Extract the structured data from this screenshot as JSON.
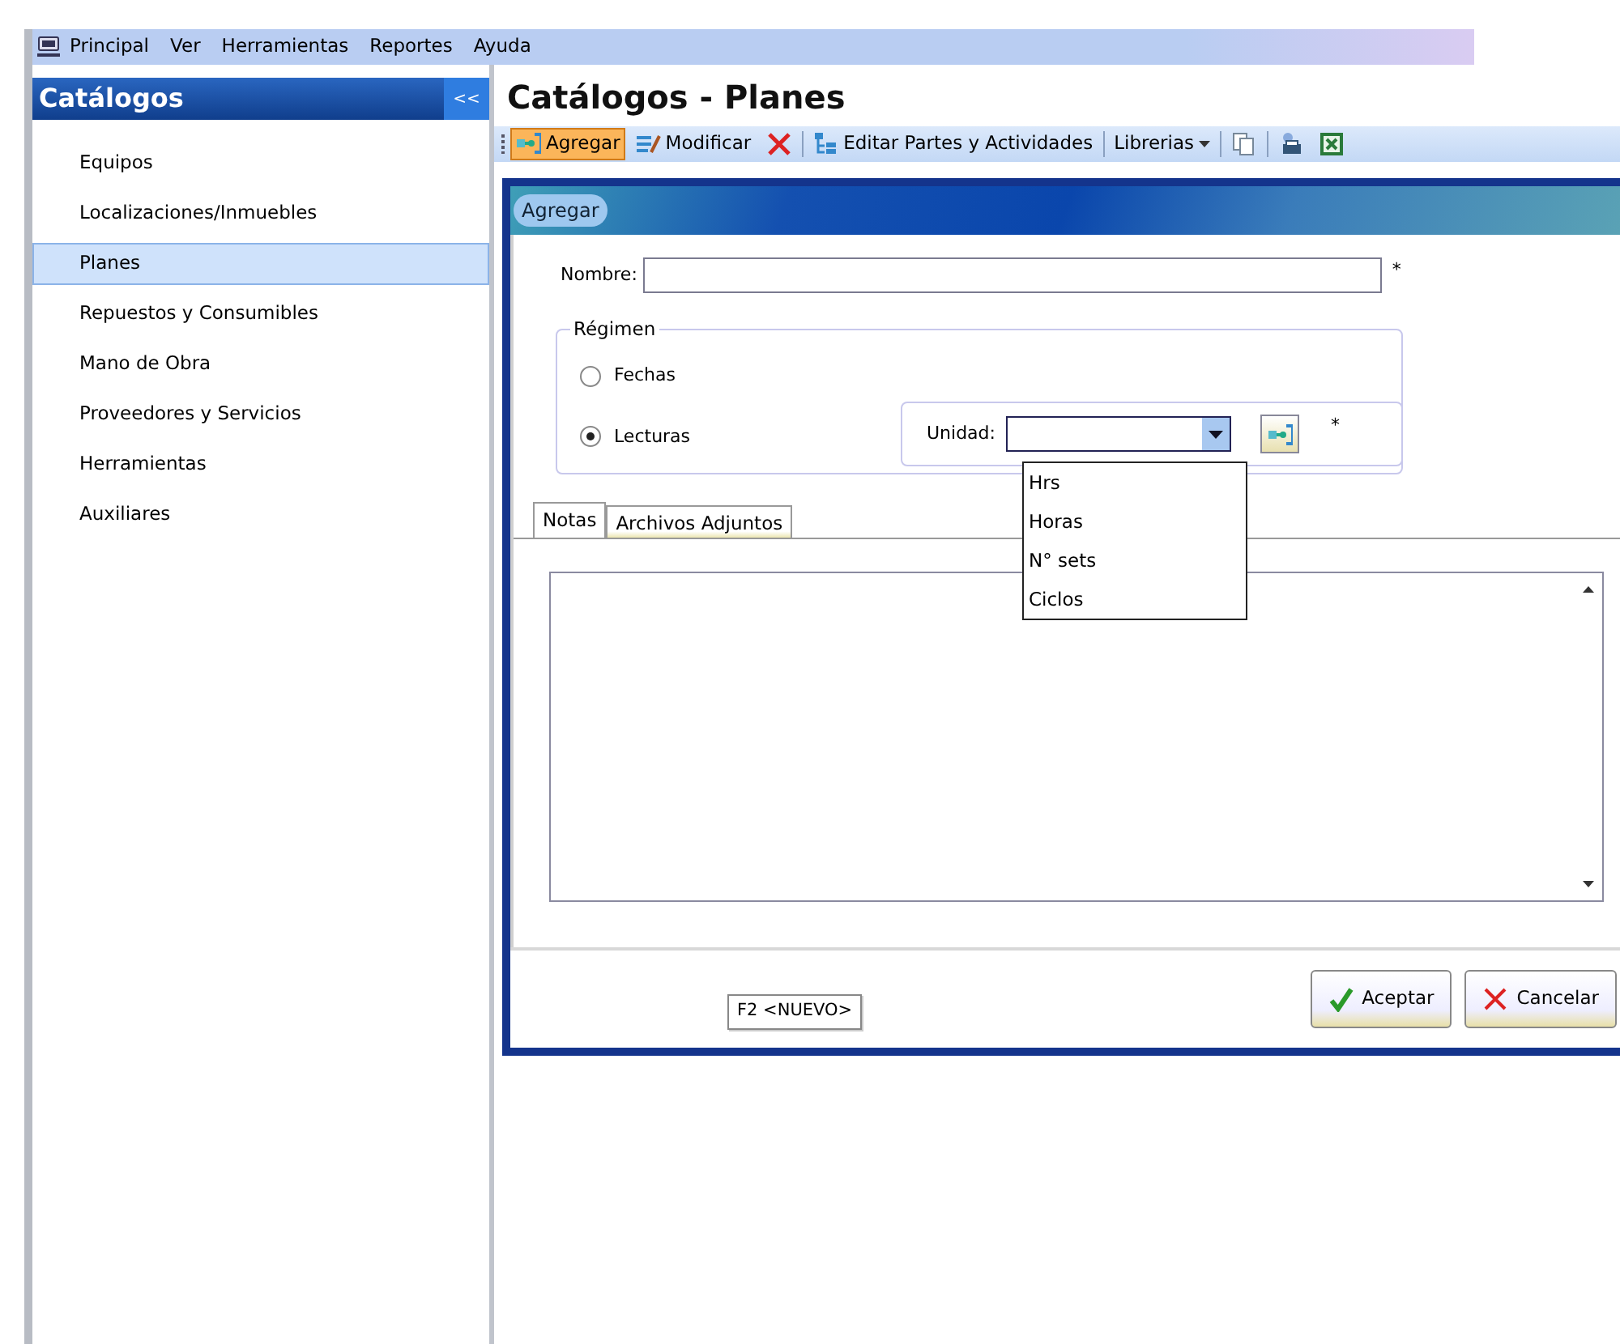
{
  "menu": [
    {
      "label": "Principal"
    },
    {
      "label": "Ver"
    },
    {
      "label": "Herramientas"
    },
    {
      "label": "Reportes"
    },
    {
      "label": "Ayuda"
    }
  ],
  "sidebar": {
    "title": "Catálogos",
    "collapse": "<<",
    "items": [
      {
        "label": "Equipos",
        "selected": false
      },
      {
        "label": "Localizaciones/Inmuebles",
        "selected": false
      },
      {
        "label": "Planes",
        "selected": true
      },
      {
        "label": "Repuestos y Consumibles",
        "selected": false
      },
      {
        "label": "Mano de Obra",
        "selected": false
      },
      {
        "label": "Proveedores y Servicios",
        "selected": false
      },
      {
        "label": "Herramientas",
        "selected": false
      },
      {
        "label": "Auxiliares",
        "selected": false
      }
    ]
  },
  "page_title": "Catálogos - Planes",
  "toolbar": [
    {
      "kind": "button",
      "label": "Agregar",
      "selected": true
    },
    {
      "kind": "button",
      "label": "Modificar",
      "selected": false
    },
    {
      "kind": "button",
      "selected": false
    },
    {
      "kind": "sep"
    },
    {
      "kind": "button",
      "label": "Editar Partes y Actividades",
      "selected": false
    },
    {
      "kind": "sep"
    },
    {
      "kind": "dropdown",
      "label": "Librerias",
      "selected": false
    },
    {
      "kind": "sep"
    },
    {
      "kind": "button",
      "selected": false
    },
    {
      "kind": "sep"
    },
    {
      "kind": "button",
      "selected": false
    },
    {
      "kind": "button",
      "selected": false
    }
  ],
  "dialog": {
    "title": "Agregar",
    "nombre": {
      "label": "Nombre:",
      "required": "*"
    },
    "regimen": {
      "legend": "Régimen",
      "options": [
        {
          "label": "Fechas",
          "selected": false
        },
        {
          "label": "Lecturas",
          "selected": true
        }
      ]
    },
    "unidad": {
      "label": "Unidad:",
      "required": "*",
      "expanded": true,
      "options": [
        {
          "label": "Hrs"
        },
        {
          "label": "Horas"
        },
        {
          "label": "N° sets"
        },
        {
          "label": "Ciclos"
        }
      ]
    },
    "tabs": [
      {
        "label": "Notas",
        "selected": true
      },
      {
        "label": "Archivos Adjuntos",
        "selected": false
      }
    ],
    "status": "F2 <NUEVO>",
    "buttons": [
      {
        "label": "Aceptar"
      },
      {
        "label": "Cancelar"
      }
    ]
  }
}
